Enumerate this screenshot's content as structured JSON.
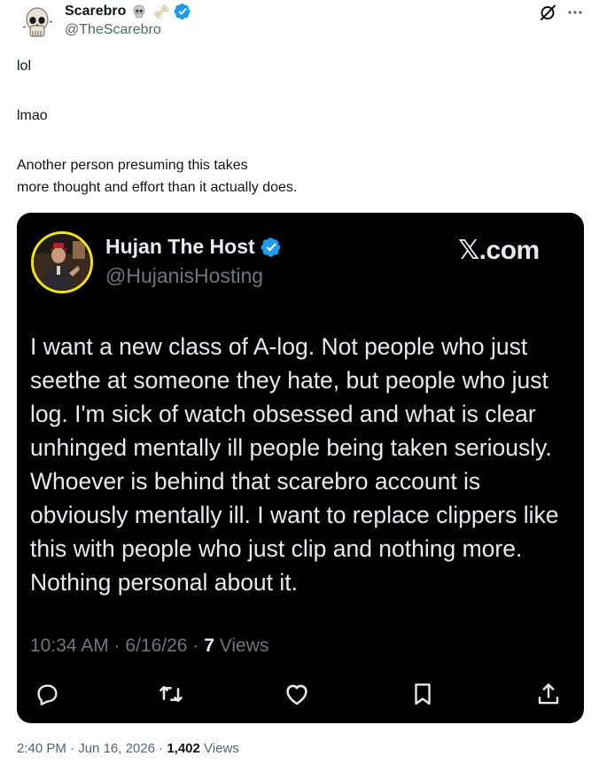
{
  "author": {
    "display_name": "Scarebro",
    "handle": "@TheScarebro",
    "emoji_icons": [
      "skull-icon",
      "bone-icon"
    ],
    "verified": true
  },
  "post": {
    "paragraphs": [
      "lol",
      "lmao",
      "Another person presuming this takes\nmore thought and effort than it actually does."
    ],
    "time": "2:40 PM",
    "date": "Jun 16, 2026",
    "separator": "·",
    "views_count": "1,402",
    "views_label": "Views"
  },
  "embedded": {
    "display_name": "Hujan The Host",
    "handle": "@HujanisHosting",
    "brand": "𝕏.com",
    "body": "I want a new class of A-log. Not people who just seethe at someone they hate, but people who just log. I'm sick of watch obsessed and what is clear unhinged mentally ill people being taken seriously. Whoever is behind that scarebro account is obviously mentally ill. I want to replace clippers like this with people who just clip and nothing more. Nothing personal about it.",
    "time": "10:34 AM",
    "date": "6/16/26",
    "separator": "·",
    "views_count": "7",
    "views_label": "Views",
    "actions": [
      "reply-icon",
      "repost-icon",
      "like-icon",
      "bookmark-icon",
      "share-icon"
    ]
  },
  "colors": {
    "verified_blue": "#1d9bf0",
    "text_primary": "#0f1419",
    "text_secondary": "#536471",
    "card_bg": "#000000",
    "card_text": "#e7e9ea",
    "card_muted": "#71767b",
    "avatar_ring": "#f5e21a"
  }
}
